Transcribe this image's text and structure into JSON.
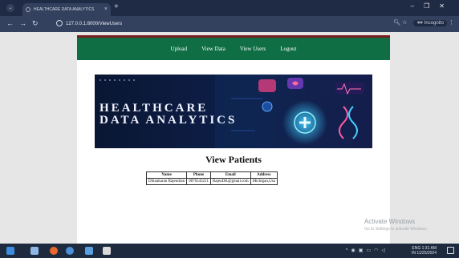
{
  "browser": {
    "tab_title": "HEALTHCARE DATA ANALYTICS",
    "url": "127.0.0.1:8000/ViewUsers",
    "incognito_label": "Incognito"
  },
  "nav": {
    "items": [
      "Upload",
      "View Data",
      "View Users",
      "Logout"
    ]
  },
  "banner": {
    "title_line1": "HEALTHCARE",
    "title_line2": "DATA ANALYTICS"
  },
  "page_heading": "View Patients",
  "table": {
    "headers": [
      "Name",
      "Phone",
      "Email",
      "Address"
    ],
    "rows": [
      [
        "Dhinakaran Rajendran",
        "9876543211",
        "RajenDK@gmail.com",
        "Michigan,Usa"
      ]
    ]
  },
  "watermark": {
    "line1": "Activate Windows",
    "line2": "Go to Settings to activate Windows."
  },
  "taskbar": {
    "lang1": "ENG",
    "lang2": "IN",
    "time": "1:31 AM",
    "date": "11/25/2024"
  },
  "colors": {
    "nav_bg": "#0f6e44",
    "top_accent": "#7a1d1d",
    "banner_bg": "#0b1a3d"
  }
}
